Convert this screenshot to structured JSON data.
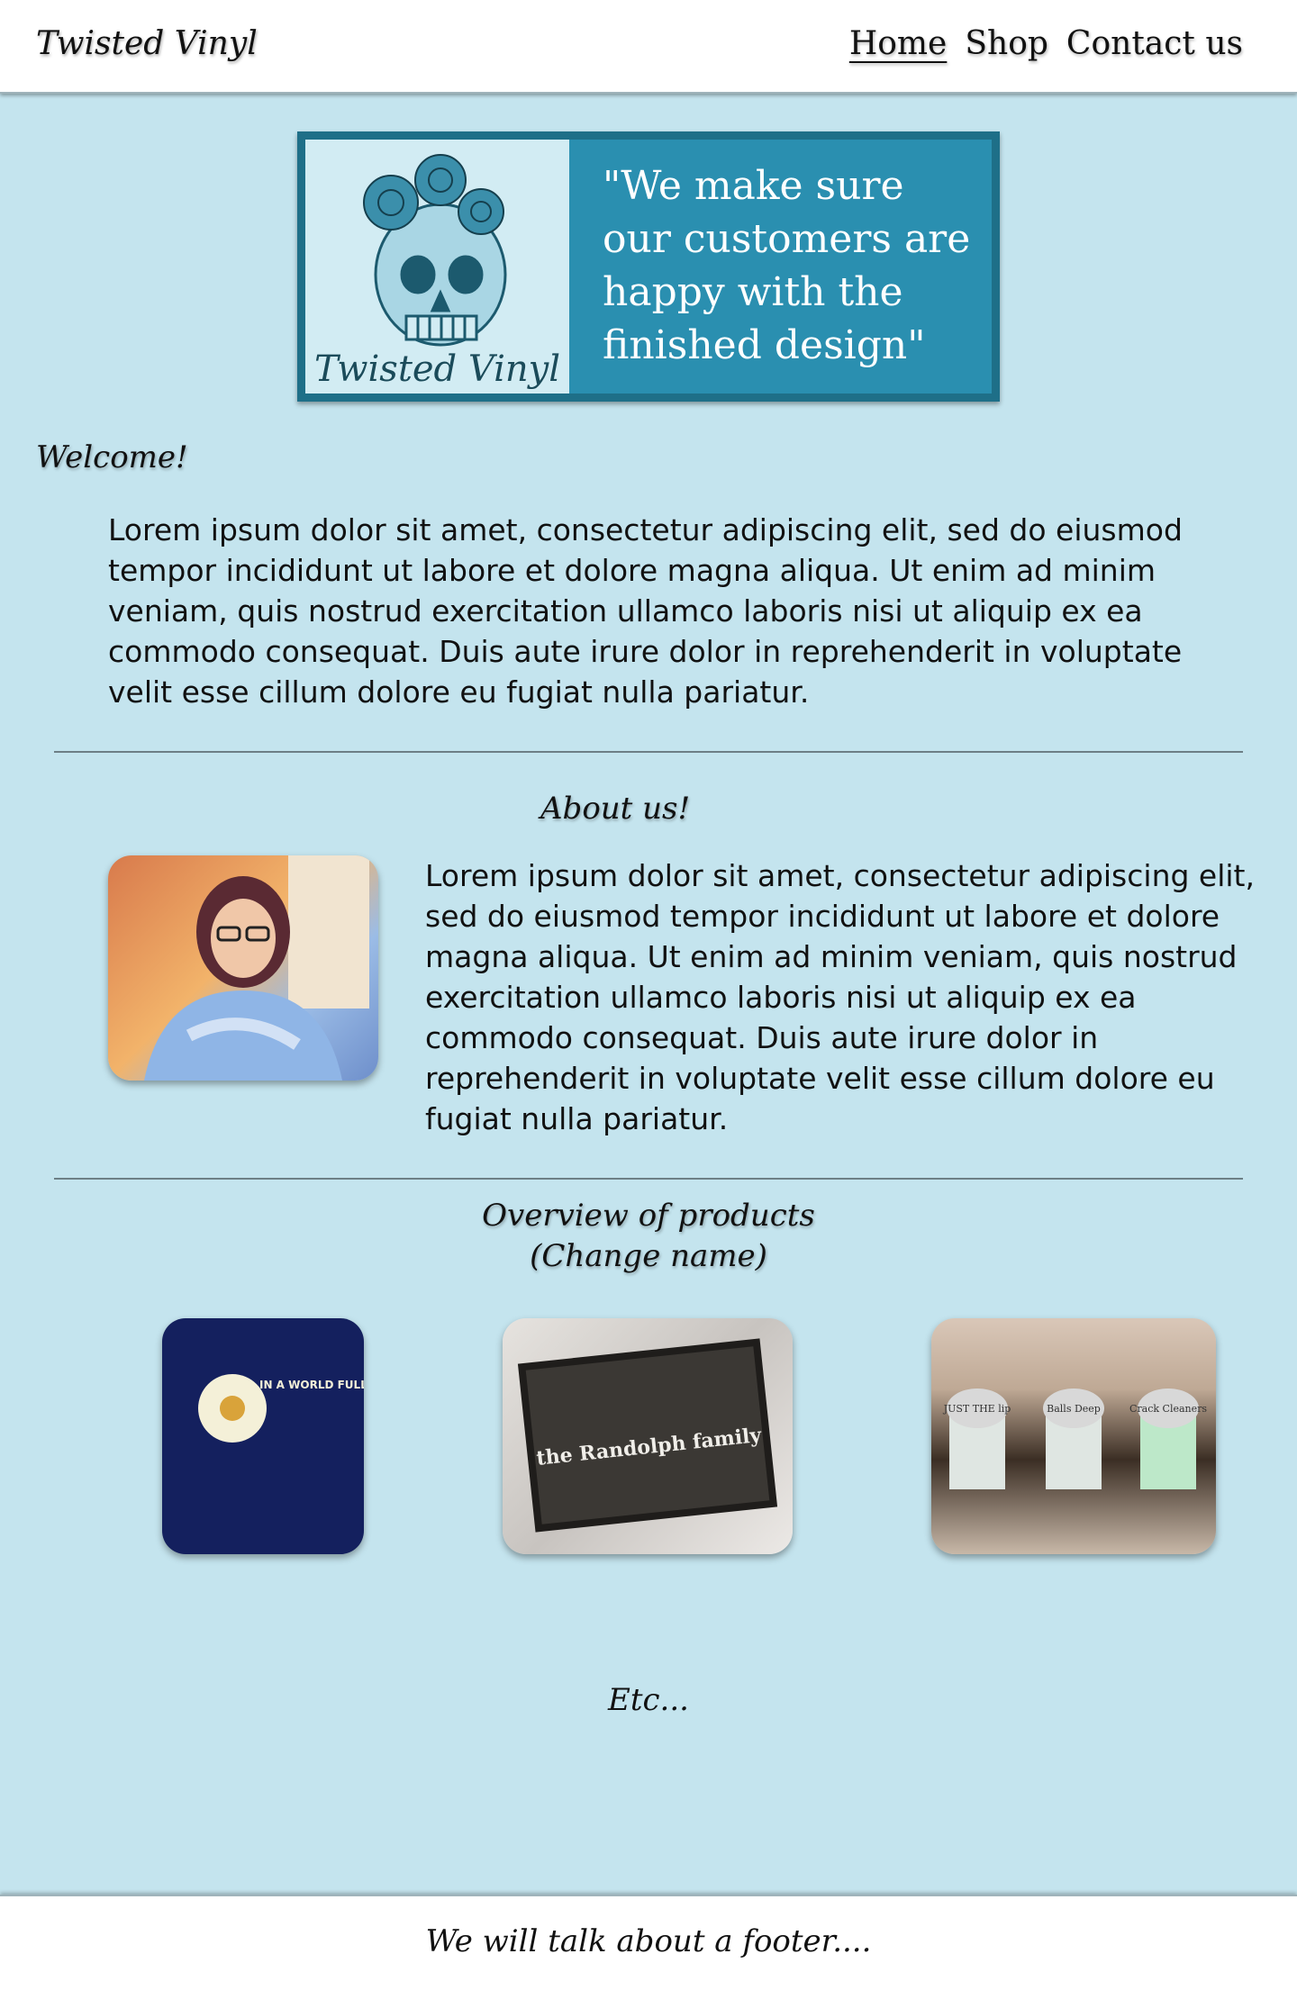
{
  "header": {
    "brand": "Twisted Vinyl",
    "nav": [
      "Home",
      "Shop",
      "Contact us"
    ]
  },
  "hero": {
    "logo_text": "Twisted Vinyl",
    "quote": "\"We make sure our customers are happy with the finished design\""
  },
  "welcome": {
    "title": "Welcome!",
    "text": "Lorem ipsum dolor sit amet, consectetur adipiscing elit, sed do eiusmod tempor incididunt ut labore et dolore magna aliqua. Ut enim ad minim veniam, quis nostrud exercitation ullamco laboris nisi ut aliquip ex ea commodo consequat. Duis aute irure dolor in reprehenderit in voluptate velit esse cillum dolore eu fugiat nulla pariatur."
  },
  "about": {
    "title": "About us!",
    "text": "Lorem ipsum dolor sit amet, consectetur adipiscing elit, sed do eiusmod tempor incididunt ut labore et dolore magna aliqua. Ut enim ad minim veniam, quis nostrud exercitation ullamco laboris nisi ut aliquip ex ea commodo consequat. Duis aute irure dolor in reprehenderit in voluptate velit esse cillum dolore eu fugiat nulla pariatur."
  },
  "products": {
    "title_line1": "Overview of products",
    "title_line2": "(Change name)",
    "items": [
      {
        "caption": "IN A WORLD FULL OF GRANDMAS BE A MIMI"
      },
      {
        "caption": "the Randolph family"
      },
      {
        "labels": [
          "JUST THE lip",
          "Balls Deep",
          "Crack Cleaners"
        ]
      }
    ]
  },
  "etc": "Etc...",
  "footer": {
    "text": "We will talk about a footer...."
  }
}
